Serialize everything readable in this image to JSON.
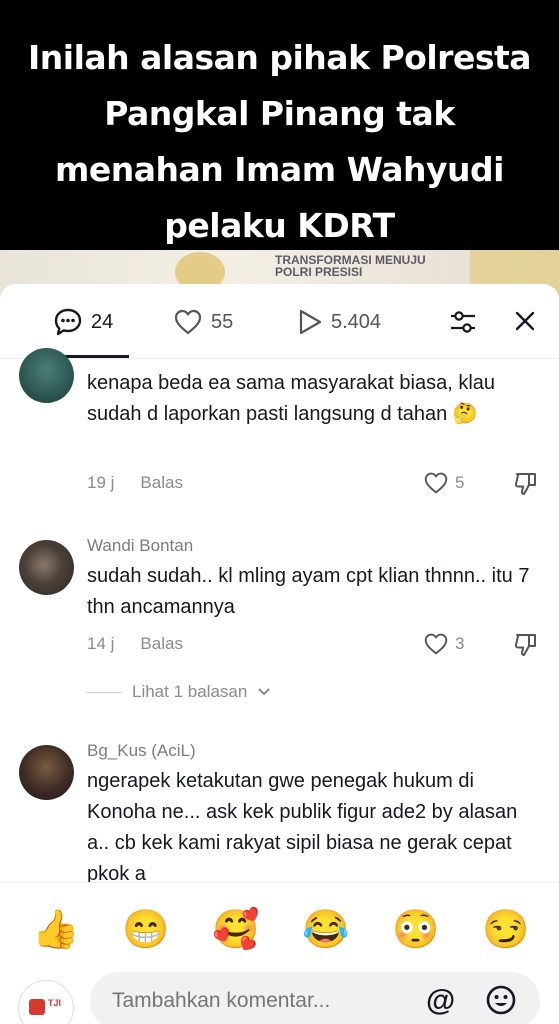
{
  "video": {
    "headline": "Inilah alasan pihak Polresta Pangkal Pinang tak menahan Imam Wahyudi pelaku KDRT",
    "strip_text": "TRANSFORMASI MENUJU POLRI PRESISI"
  },
  "tabs": {
    "comments_count": "24",
    "likes_count": "55",
    "views_count": "5.404"
  },
  "comments": [
    {
      "name": "",
      "text": "kenapa beda ea sama masyarakat biasa, klau sudah d laporkan pasti langsung d tahan 🤔",
      "time": "19 j",
      "reply_label": "Balas",
      "likes": "5"
    },
    {
      "name": "Wandi Bontan",
      "text": "sudah sudah.. kl mling ayam cpt klian thnnn.. itu 7 thn ancamannya",
      "time": "14 j",
      "reply_label": "Balas",
      "likes": "3"
    },
    {
      "name": "Bg_Kus (AciL)",
      "text": "ngerapek ketakutan gwe penegak hukum di Konoha ne... ask kek publik figur ade2 by alasan a.. cb kek kami rakyat sipil biasa ne gerak cepat pkok a"
    }
  ],
  "more_replies": "Lihat 1 balasan",
  "emojis": [
    "👍",
    "😁",
    "🥰",
    "😂",
    "😳",
    "😏"
  ],
  "input": {
    "placeholder": "Tambahkan komentar...",
    "at_symbol": "@",
    "logo_text": "TJI"
  }
}
